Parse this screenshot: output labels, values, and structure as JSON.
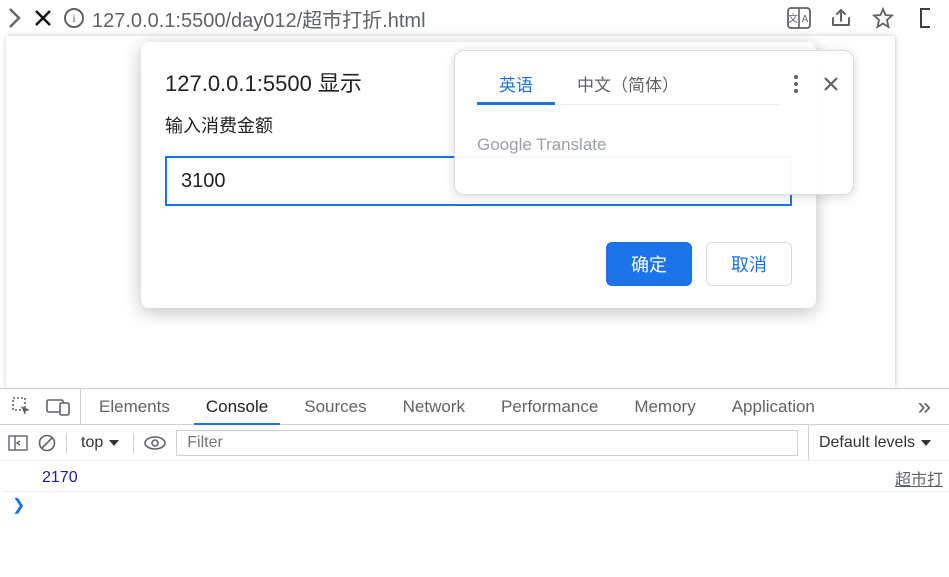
{
  "browser": {
    "url": "127.0.0.1:5500/day012/超巿打折.html"
  },
  "prompt": {
    "origin_label": "127.0.0.1:5500 显示",
    "message": "输入消费金额",
    "value": "3100",
    "ok_label": "确定",
    "cancel_label": "取消"
  },
  "translate": {
    "tab_source": "英语",
    "tab_target": "中文（简体）",
    "brand": "Google Translate"
  },
  "devtools": {
    "tabs": {
      "elements": "Elements",
      "console": "Console",
      "sources": "Sources",
      "network": "Network",
      "performance": "Performance",
      "memory": "Memory",
      "application": "Application"
    },
    "toolbar": {
      "context": "top",
      "filter_placeholder": "Filter",
      "levels_label": "Default levels"
    },
    "log": {
      "value": "2170",
      "source": "超市打"
    }
  }
}
